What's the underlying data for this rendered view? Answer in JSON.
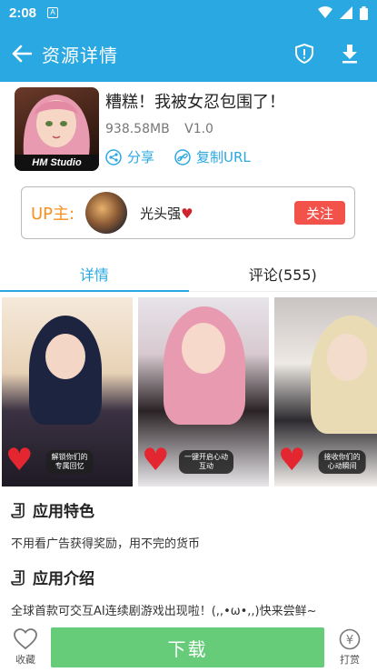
{
  "status_bar": {
    "time": "2:08",
    "notification_letter": "A"
  },
  "app_bar": {
    "title": "资源详情"
  },
  "app": {
    "icon_text": "HM Studio",
    "name": "糟糕！我被女忍包围了！",
    "size": "938.58MB",
    "version": "V1.0",
    "share_label": "分享",
    "copy_url_label": "复制URL"
  },
  "uploader": {
    "label": "UP主:",
    "name": "光头强",
    "heart": "♥",
    "follow_label": "关注"
  },
  "tabs": [
    {
      "label": "详情",
      "active": true
    },
    {
      "label": "评论(555)",
      "active": false
    }
  ],
  "gallery": [
    {
      "caption": "解锁你们的\n专属回忆"
    },
    {
      "caption": "一键开启心动\n互动"
    },
    {
      "caption": "接收你们的\n心动瞬间"
    }
  ],
  "features": {
    "title": "应用特色",
    "body": "不用看广告获得奖励，用不完的货币"
  },
  "intro": {
    "title": "应用介绍",
    "body": "全球首款可交互AI连续剧游戏出现啦！(,,•ω•,,)快来尝鲜~"
  },
  "bottom_bar": {
    "favorite_label": "收藏",
    "download_label": "下载",
    "tip_label": "打赏",
    "tip_symbol": "¥"
  },
  "colors": {
    "accent": "#2aa8e2",
    "follow": "#f2524a",
    "download": "#66cc7a",
    "up_label": "#f5901f"
  }
}
